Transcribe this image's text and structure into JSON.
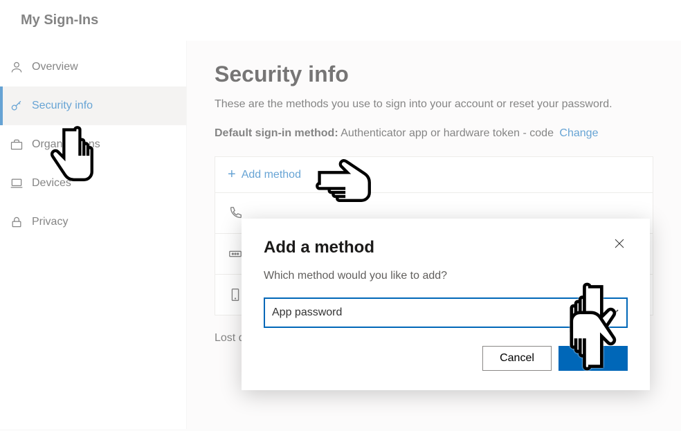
{
  "header": {
    "title": "My Sign-Ins"
  },
  "sidebar": {
    "items": [
      {
        "label": "Overview"
      },
      {
        "label": "Security info"
      },
      {
        "label": "Organizations"
      },
      {
        "label": "Devices"
      },
      {
        "label": "Privacy"
      }
    ]
  },
  "main": {
    "title": "Security info",
    "subtitle": "These are the methods you use to sign into your account or reset your password.",
    "default_label": "Default sign-in method:",
    "default_value": "Authenticator app or hardware token - code",
    "change_link": "Change",
    "add_method_label": "Add method",
    "lost_text": "Lost d"
  },
  "dialog": {
    "title": "Add a method",
    "prompt": "Which method would you like to add?",
    "selected": "App password",
    "cancel": "Cancel",
    "add": "Add"
  }
}
